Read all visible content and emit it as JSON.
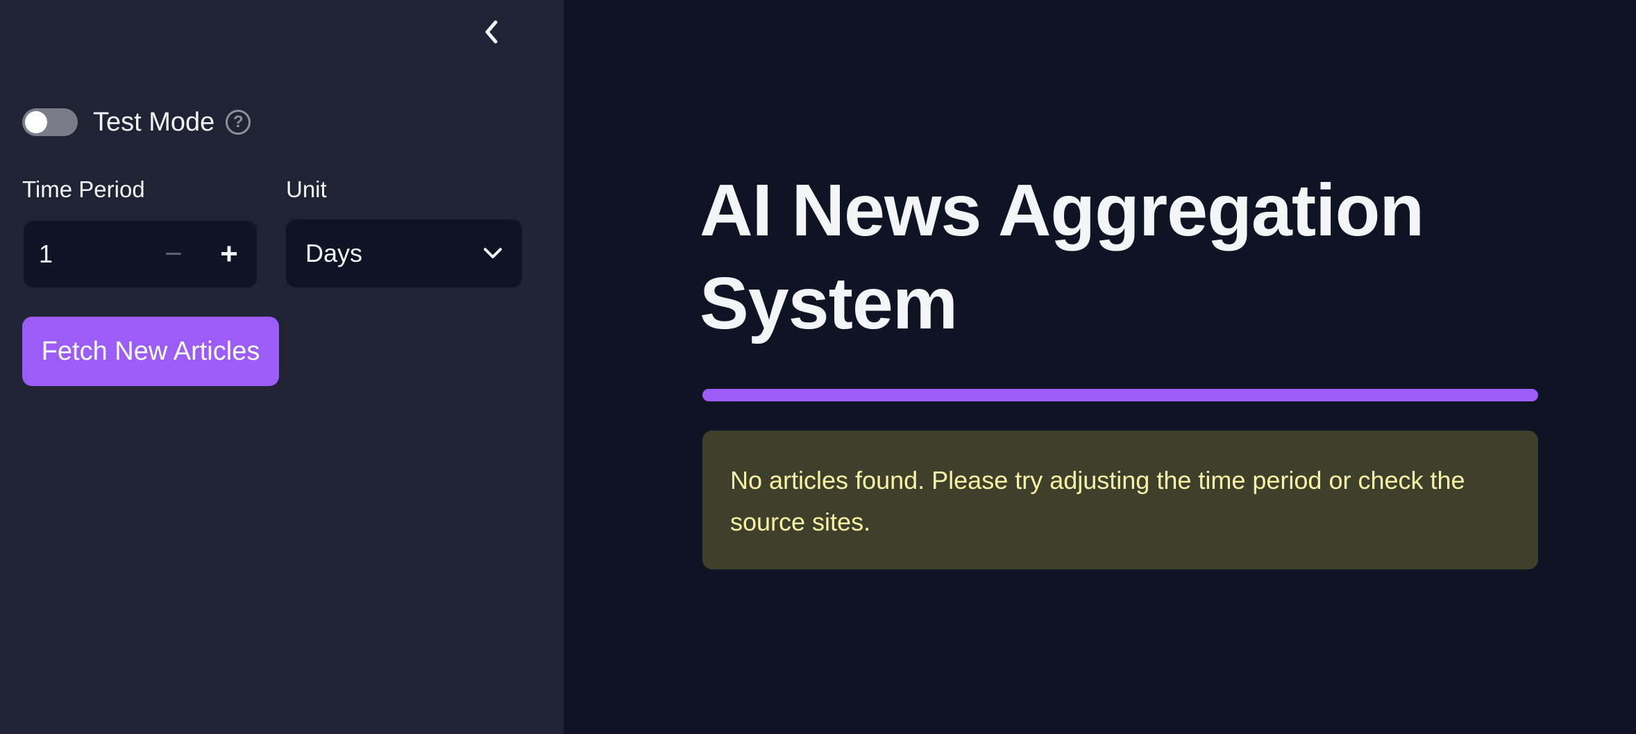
{
  "sidebar": {
    "collapse_icon": "chevron-left-icon",
    "test_mode": {
      "label": "Test Mode",
      "enabled": false,
      "help_icon": "question-circle-icon",
      "help_glyph": "?"
    },
    "time_period": {
      "label": "Time Period",
      "value": "1",
      "minus_glyph": "−",
      "plus_glyph": "+"
    },
    "unit": {
      "label": "Unit",
      "selected": "Days",
      "icon": "chevron-down-icon"
    },
    "fetch_button_label": "Fetch New Articles"
  },
  "main": {
    "title": "AI News Aggregation System",
    "alert": {
      "message": "No articles found. Please try adjusting the time period or check the source sites."
    }
  },
  "colors": {
    "sidebar_bg": "#1f2334",
    "main_bg": "#0e1424",
    "accent": "#9b5cf8",
    "warning_bg": "#3e402c",
    "warning_text": "#faf3a6"
  }
}
